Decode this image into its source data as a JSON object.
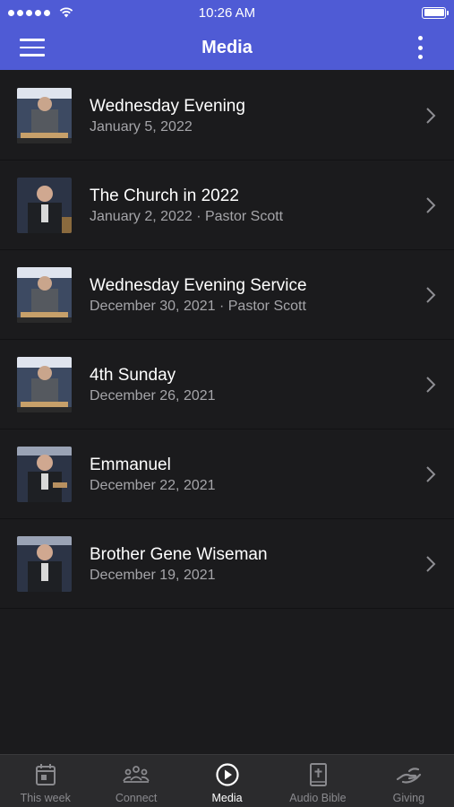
{
  "status_bar": {
    "time": "10:26 AM"
  },
  "header": {
    "title": "Media"
  },
  "media_items": [
    {
      "title": "Wednesday Evening",
      "subtitle": "January 5, 2022"
    },
    {
      "title": "The Church in 2022",
      "subtitle": "January 2, 2022 · Pastor Scott"
    },
    {
      "title": "Wednesday Evening Service",
      "subtitle": "December 30, 2021 · Pastor Scott"
    },
    {
      "title": "4th Sunday",
      "subtitle": "December 26, 2021"
    },
    {
      "title": "Emmanuel",
      "subtitle": "December 22, 2021"
    },
    {
      "title": "Brother Gene Wiseman",
      "subtitle": "December 19, 2021"
    }
  ],
  "tabs": [
    {
      "label": "This week",
      "icon": "calendar-icon",
      "active": false
    },
    {
      "label": "Connect",
      "icon": "people-icon",
      "active": false
    },
    {
      "label": "Media",
      "icon": "play-circle-icon",
      "active": true
    },
    {
      "label": "Audio Bible",
      "icon": "bible-icon",
      "active": false
    },
    {
      "label": "Giving",
      "icon": "giving-hand-icon",
      "active": false
    }
  ],
  "colors": {
    "accent": "#4f5bd5",
    "background": "#1b1b1d",
    "tab_bar": "#2b2b2d",
    "subtitle": "#a5a5a9"
  }
}
